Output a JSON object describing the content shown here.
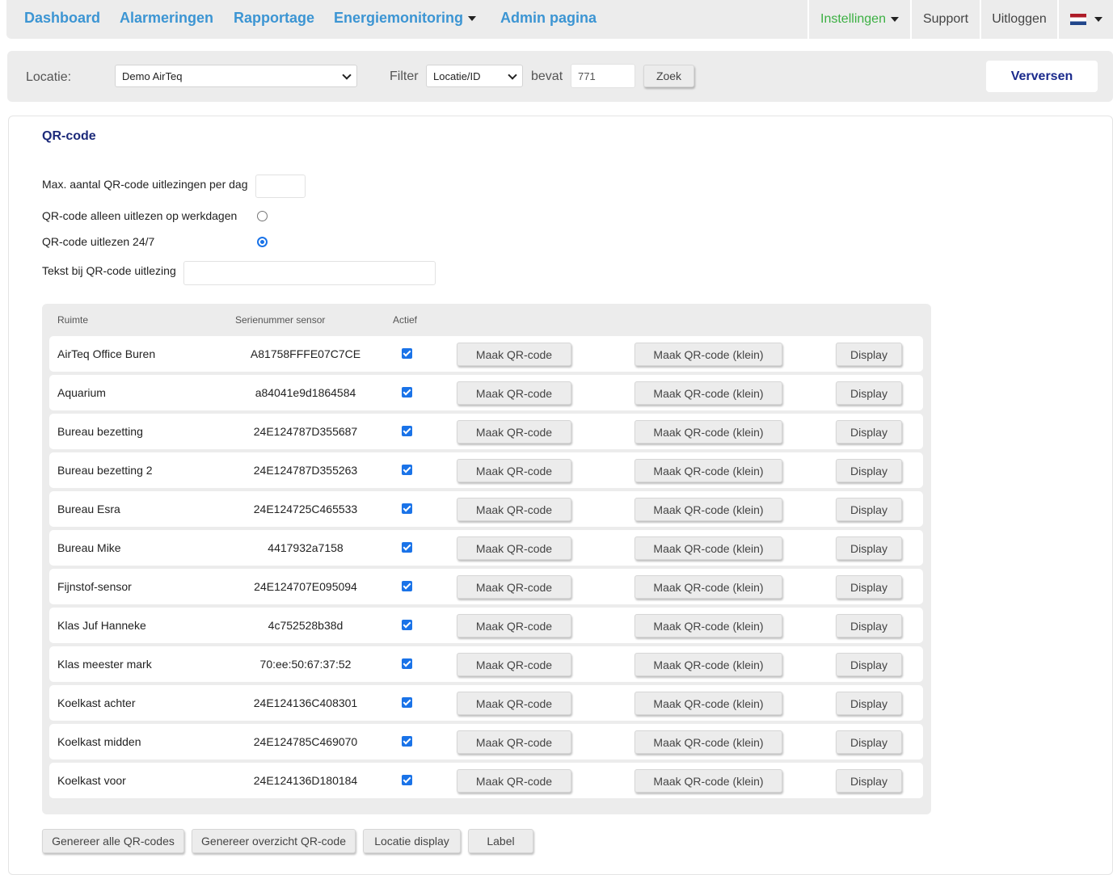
{
  "nav": {
    "dashboard": "Dashboard",
    "alarms": "Alarmeringen",
    "reports": "Rapportage",
    "energy": "Energiemonitoring",
    "admin": "Admin pagina",
    "settings": "Instellingen",
    "support": "Support",
    "logout": "Uitloggen",
    "flag_icon": "netherlands-flag-icon"
  },
  "locbar": {
    "location_label": "Locatie:",
    "location_value": "Demo AirTeq",
    "filter_label": "Filter",
    "filter_value": "Locatie/ID",
    "contains_label": "bevat",
    "search_value": "771",
    "search_button": "Zoek",
    "refresh_button": "Verversen"
  },
  "qr": {
    "title": "QR-code",
    "max_label": "Max. aantal QR-code uitlezingen per dag",
    "max_value": "",
    "workdays_label": "QR-code alleen uitlezen op werkdagen",
    "always_label": "QR-code uitlezen 24/7",
    "selected_mode": "24/7",
    "text_label": "Tekst bij QR-code uitlezing",
    "text_value": ""
  },
  "table": {
    "headers": {
      "room": "Ruimte",
      "serial": "Serienummer sensor",
      "active": "Actief"
    },
    "button_labels": {
      "make": "Maak QR-code",
      "make_small": "Maak QR-code (klein)",
      "display": "Display"
    },
    "rows": [
      {
        "room": "AirTeq Office Buren",
        "serial": "A81758FFFE07C7CE",
        "active": true
      },
      {
        "room": "Aquarium",
        "serial": "a84041e9d1864584",
        "active": true
      },
      {
        "room": "Bureau bezetting",
        "serial": "24E124787D355687",
        "active": true
      },
      {
        "room": "Bureau bezetting 2",
        "serial": "24E124787D355263",
        "active": true
      },
      {
        "room": "Bureau Esra",
        "serial": "24E124725C465533",
        "active": true
      },
      {
        "room": "Bureau Mike",
        "serial": "4417932a7158",
        "active": true
      },
      {
        "room": "Fijnstof-sensor",
        "serial": "24E124707E095094",
        "active": true
      },
      {
        "room": "Klas Juf Hanneke",
        "serial": "4c752528b38d",
        "active": true
      },
      {
        "room": "Klas meester mark",
        "serial": "70:ee:50:67:37:52",
        "active": true
      },
      {
        "room": "Koelkast achter",
        "serial": "24E124136C408301",
        "active": true
      },
      {
        "room": "Koelkast midden",
        "serial": "24E124785C469070",
        "active": true
      },
      {
        "room": "Koelkast voor",
        "serial": "24E124136D180184",
        "active": true
      }
    ]
  },
  "footer": {
    "generate_all": "Genereer alle QR-codes",
    "generate_overview": "Genereer overzicht QR-code",
    "location_display": "Locatie display",
    "label": "Label"
  },
  "colors": {
    "nav_link": "#3c95d3",
    "settings_link": "#3cb043",
    "title": "#1c2a7a",
    "checkbox": "#1a73e8",
    "panel_bg": "#ececec"
  }
}
